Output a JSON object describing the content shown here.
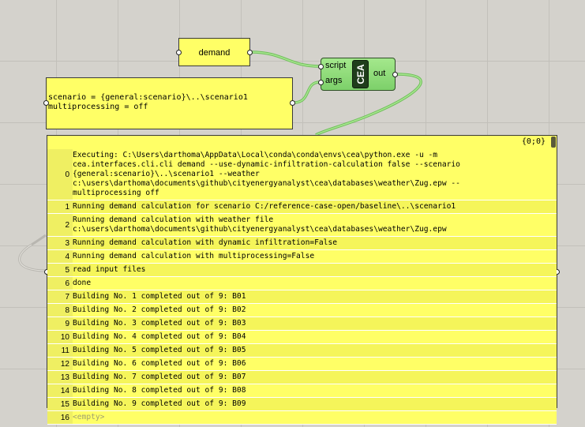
{
  "demand_panel": {
    "text": "demand"
  },
  "scenario_panel": {
    "lines": [
      "scenario = {general:scenario}\\..\\scenario1",
      "multiprocessing = off"
    ]
  },
  "component": {
    "inputs": [
      "script",
      "args"
    ],
    "badge": "CEA",
    "output": "out"
  },
  "output_panel": {
    "path": "{0;0}",
    "rows": [
      {
        "index": "0",
        "text": "Executing: C:\\Users\\darthoma\\AppData\\Local\\conda\\conda\\envs\\cea\\python.exe -u -m\ncea.interfaces.cli.cli demand --use-dynamic-infiltration-calculation false --scenario\n{general:scenario}\\..\\scenario1 --weather\nc:\\users\\darthoma\\documents\\github\\cityenergyanalyst\\cea\\databases\\weather\\Zug.epw --\nmultiprocessing off"
      },
      {
        "index": "1",
        "text": "Running demand calculation for scenario C:/reference-case-open/baseline\\..\\scenario1"
      },
      {
        "index": "2",
        "text": "Running demand calculation with weather file\nc:\\users\\darthoma\\documents\\github\\cityenergyanalyst\\cea\\databases\\weather\\Zug.epw"
      },
      {
        "index": "3",
        "text": "Running demand calculation with dynamic infiltration=False"
      },
      {
        "index": "4",
        "text": "Running demand calculation with multiprocessing=False"
      },
      {
        "index": "5",
        "text": "read input files"
      },
      {
        "index": "6",
        "text": "done"
      },
      {
        "index": "7",
        "text": "Building No. 1 completed out of 9: B01"
      },
      {
        "index": "8",
        "text": "Building No. 2 completed out of 9: B02"
      },
      {
        "index": "9",
        "text": "Building No. 3 completed out of 9: B03"
      },
      {
        "index": "10",
        "text": "Building No. 4 completed out of 9: B04"
      },
      {
        "index": "11",
        "text": "Building No. 5 completed out of 9: B05"
      },
      {
        "index": "12",
        "text": "Building No. 6 completed out of 9: B06"
      },
      {
        "index": "13",
        "text": "Building No. 7 completed out of 9: B07"
      },
      {
        "index": "14",
        "text": "Building No. 8 completed out of 9: B08"
      },
      {
        "index": "15",
        "text": "Building No. 9 completed out of 9: B09"
      },
      {
        "index": "16",
        "text": "<empty>"
      }
    ]
  },
  "colors": {
    "panel": "#ffff66",
    "component": "#8fdc78",
    "wire": "#8fdc78",
    "canvas": "#d4d2cc"
  }
}
